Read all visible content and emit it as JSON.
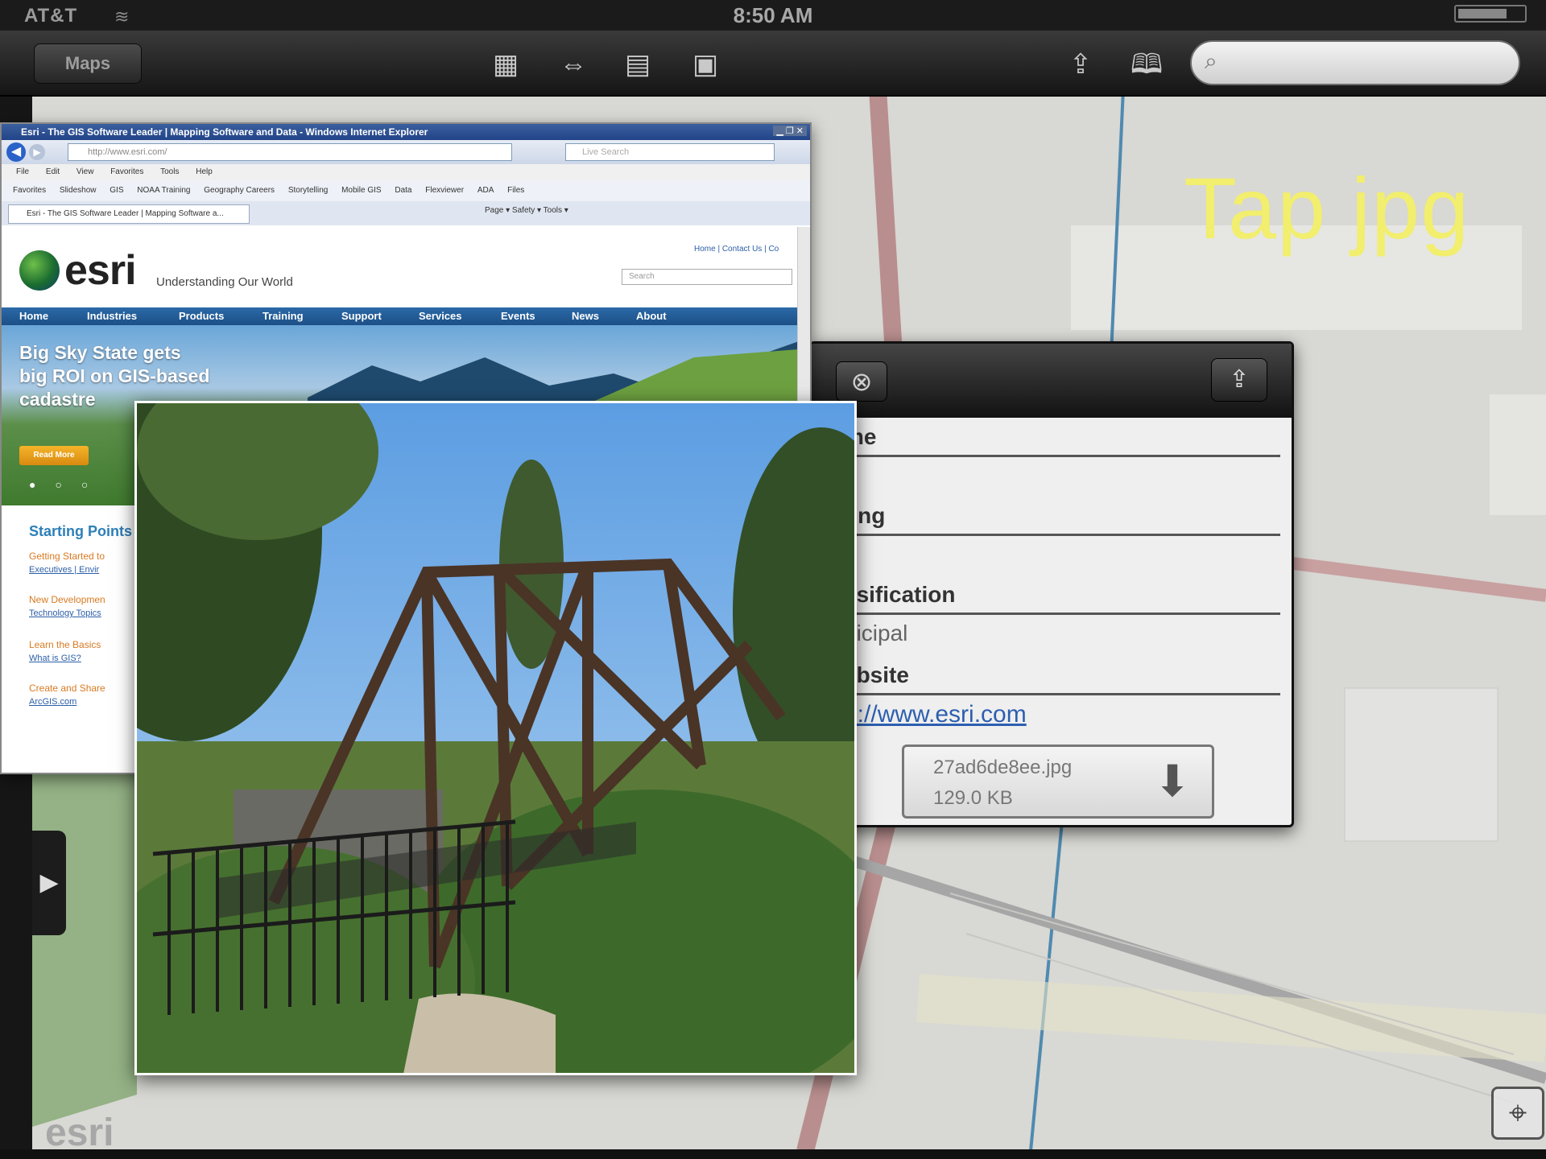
{
  "status_bar": {
    "carrier": "AT&T",
    "time": "8:50 AM"
  },
  "toolbar": {
    "maps_button": "Maps",
    "icons": [
      "basemap-icon",
      "measure-icon",
      "layers-icon",
      "gallery-icon",
      "share-icon",
      "bookmarks-icon"
    ],
    "search_placeholder": ""
  },
  "caption": "Tap jpg",
  "popup": {
    "fields": [
      {
        "label": "me",
        "value": ""
      },
      {
        "label": "ting",
        "value": ""
      },
      {
        "label": "ssification",
        "value": "nicipal"
      },
      {
        "label": "ebsite",
        "value": "p://www.esri.com"
      }
    ],
    "attachment": {
      "filename": "27ad6de8ee.jpg",
      "size": "129.0 KB"
    }
  },
  "browser": {
    "title": "Esri - The GIS Software Leader | Mapping Software and Data - Windows Internet Explorer",
    "url": "http://www.esri.com/",
    "search_placeholder": "Live Search",
    "menu": [
      "File",
      "Edit",
      "View",
      "Favorites",
      "Tools",
      "Help"
    ],
    "favorites": [
      "Favorites",
      "Slideshow",
      "GIS",
      "NOAA Training",
      "Geography Careers",
      "Storytelling",
      "Mobile GIS",
      "Data",
      "Flexviewer",
      "ADA",
      "Files"
    ],
    "tab": "Esri - The GIS Software Leader | Mapping Software a...",
    "commands": "Page ▾  Safety ▾  Tools ▾",
    "page": {
      "logo": "esri",
      "tagline": "Understanding Our World",
      "top_links": "Home | Contact Us | Co",
      "site_search": "Search",
      "nav": [
        "Home",
        "Industries",
        "Products",
        "Training",
        "Support",
        "Services",
        "Events",
        "News",
        "About"
      ],
      "hero_lines": [
        "Big Sky State gets",
        "big ROI on GIS-based",
        "cadastre"
      ],
      "read_more": "Read More",
      "starting_points_title": "Starting Points",
      "starting_points": [
        {
          "title": "Getting Started to",
          "sub": "Executives | Envir"
        },
        {
          "title": "New Developmen",
          "sub": "Technology Topics"
        },
        {
          "title": "Learn the Basics",
          "sub": "What is GIS?"
        },
        {
          "title": "Create and Share",
          "sub": "ArcGIS.com"
        }
      ]
    }
  },
  "watermark": "esri"
}
